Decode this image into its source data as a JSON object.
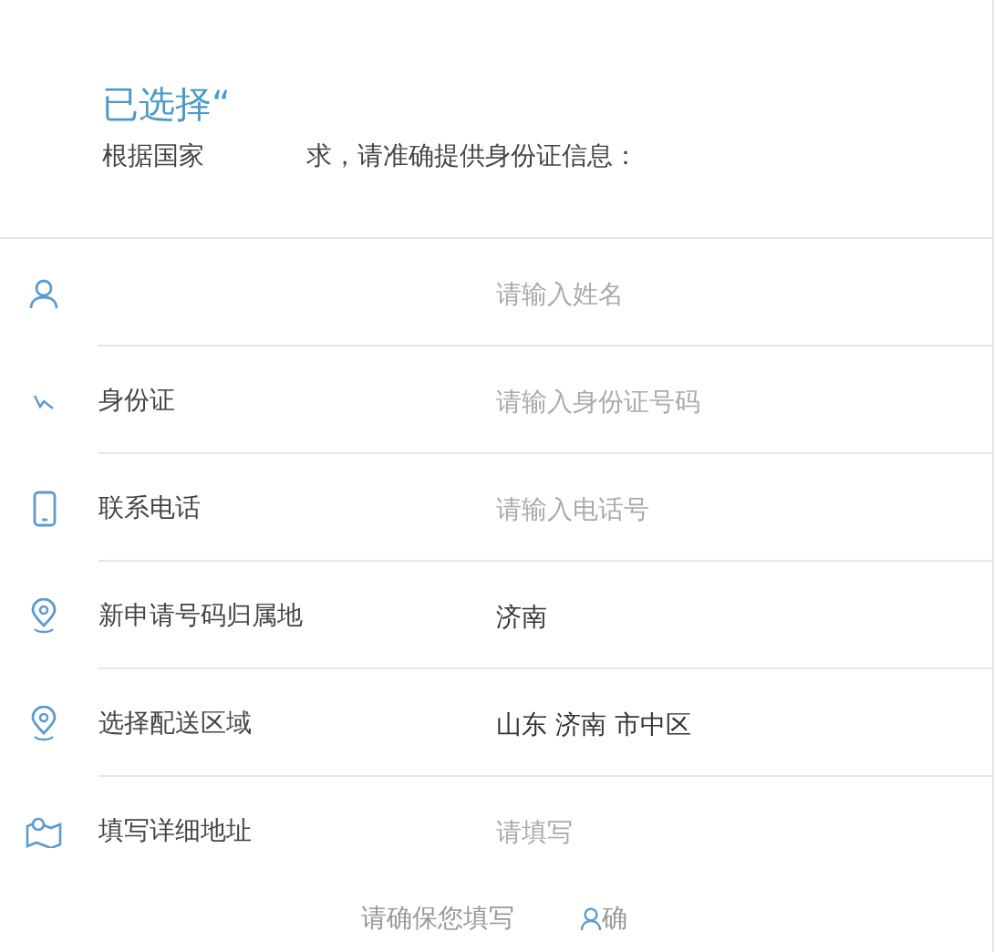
{
  "header": {
    "title": "已选择“",
    "notice_start": "根据国家",
    "notice_end": "求，请准确提供身份证信息："
  },
  "rows": [
    {
      "kind": "input",
      "placeholder": "请输入姓名"
    },
    {
      "kind": "input",
      "label": "身份证",
      "placeholder": "请输入身份证号码"
    },
    {
      "kind": "input",
      "label": "联系电话",
      "placeholder": "请输入电话号"
    },
    {
      "kind": "value",
      "label": "新申请号码归属地",
      "value": "济南"
    },
    {
      "kind": "value",
      "label": "选择配送区域",
      "value": "山东 济南 市中区"
    },
    {
      "kind": "input",
      "label": "填写详细地址",
      "placeholder": "请填写"
    }
  ],
  "footer": {
    "note_start": "请确保您填写",
    "note_end": "确"
  }
}
